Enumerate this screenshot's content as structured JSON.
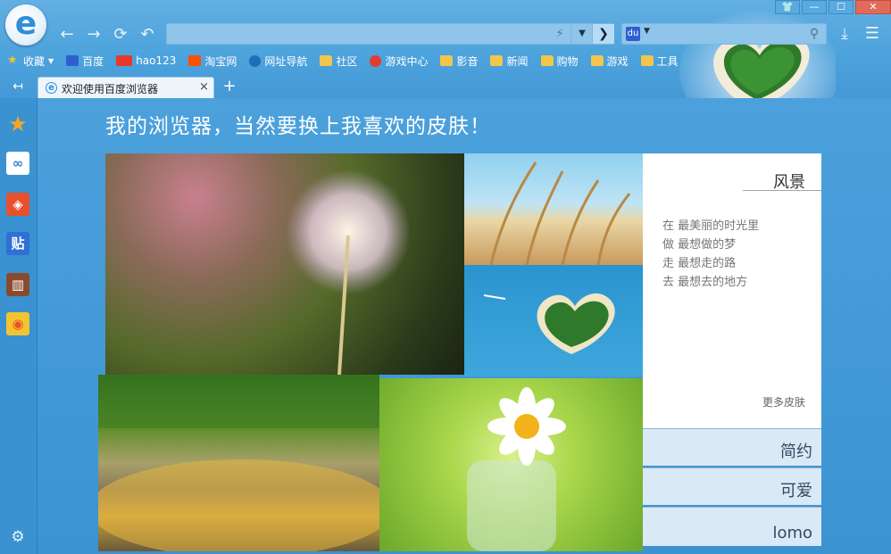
{
  "window": {
    "minimize": "—",
    "maximize": "☐",
    "close": "✕",
    "skin_icon": "shirt-icon"
  },
  "logo": {
    "glyph": "e"
  },
  "nav": {
    "back_glyph": "←",
    "forward_glyph": "→",
    "refresh_glyph": "⟳",
    "undo_glyph": "↶"
  },
  "address": {
    "value": "",
    "placeholder": "",
    "bolt_glyph": "⚡",
    "dropdown_glyph": "▼",
    "go_glyph": "❯"
  },
  "search": {
    "engine_glyph": "du",
    "dropdown_glyph": "▼",
    "value": "",
    "placeholder": "",
    "icon_glyph": "⚲"
  },
  "toolbar": {
    "download_glyph": "⤓",
    "menu_glyph": "☰"
  },
  "bookmarks": [
    {
      "label": "收藏",
      "icon": "star-icon",
      "color": "#f4c430",
      "dropdown": "▼"
    },
    {
      "label": "百度",
      "icon": "baidu-paw-icon",
      "color": "#2e5fd0"
    },
    {
      "label": "hao123",
      "icon": "hao123-icon",
      "color": "#e8382c"
    },
    {
      "label": "淘宝网",
      "icon": "taobao-icon",
      "color": "#ff5000"
    },
    {
      "label": "网址导航",
      "icon": "navigation-icon",
      "color": "#1f6fb8"
    },
    {
      "label": "社区",
      "icon": "folder-icon",
      "color": "#f2c64b"
    },
    {
      "label": "游戏中心",
      "icon": "game-center-icon",
      "color": "#e33b2d"
    },
    {
      "label": "影音",
      "icon": "folder-icon",
      "color": "#f2c64b"
    },
    {
      "label": "新闻",
      "icon": "folder-icon",
      "color": "#f2c64b"
    },
    {
      "label": "购物",
      "icon": "folder-icon",
      "color": "#f2c64b"
    },
    {
      "label": "游戏",
      "icon": "folder-icon",
      "color": "#f2c64b"
    },
    {
      "label": "工具",
      "icon": "folder-icon",
      "color": "#f2c64b"
    }
  ],
  "tabs": {
    "back_glyph": "↤",
    "active_title": "欢迎使用百度浏览器",
    "close_glyph": "×",
    "new_glyph": "+"
  },
  "sidebar": [
    {
      "name": "favorites-icon",
      "glyph": "★",
      "color": "#f6a623"
    },
    {
      "name": "baidu-cloud-icon",
      "glyph": "∞",
      "color": "#2f7fd6"
    },
    {
      "name": "app-center-icon",
      "glyph": "◈",
      "color": "#e8502e"
    },
    {
      "name": "tieba-icon",
      "glyph": "贴",
      "color": "#2f6fd6"
    },
    {
      "name": "reader-icon",
      "glyph": "▥",
      "color": "#8a4b2d"
    },
    {
      "name": "weibo-icon",
      "glyph": "◉",
      "color": "#e94f2d"
    }
  ],
  "settings_glyph": "⚙",
  "content": {
    "headline": "我的浏览器，当然要换上我喜欢的皮肤！",
    "panel": {
      "title": "风景",
      "poem": [
        "在 最美丽的时光里",
        "做 最想做的梦",
        "走 最想走的路",
        "去 最想去的地方"
      ],
      "more": "更多皮肤"
    },
    "skin_categories": [
      "简约",
      "可爱",
      "lomo"
    ]
  }
}
